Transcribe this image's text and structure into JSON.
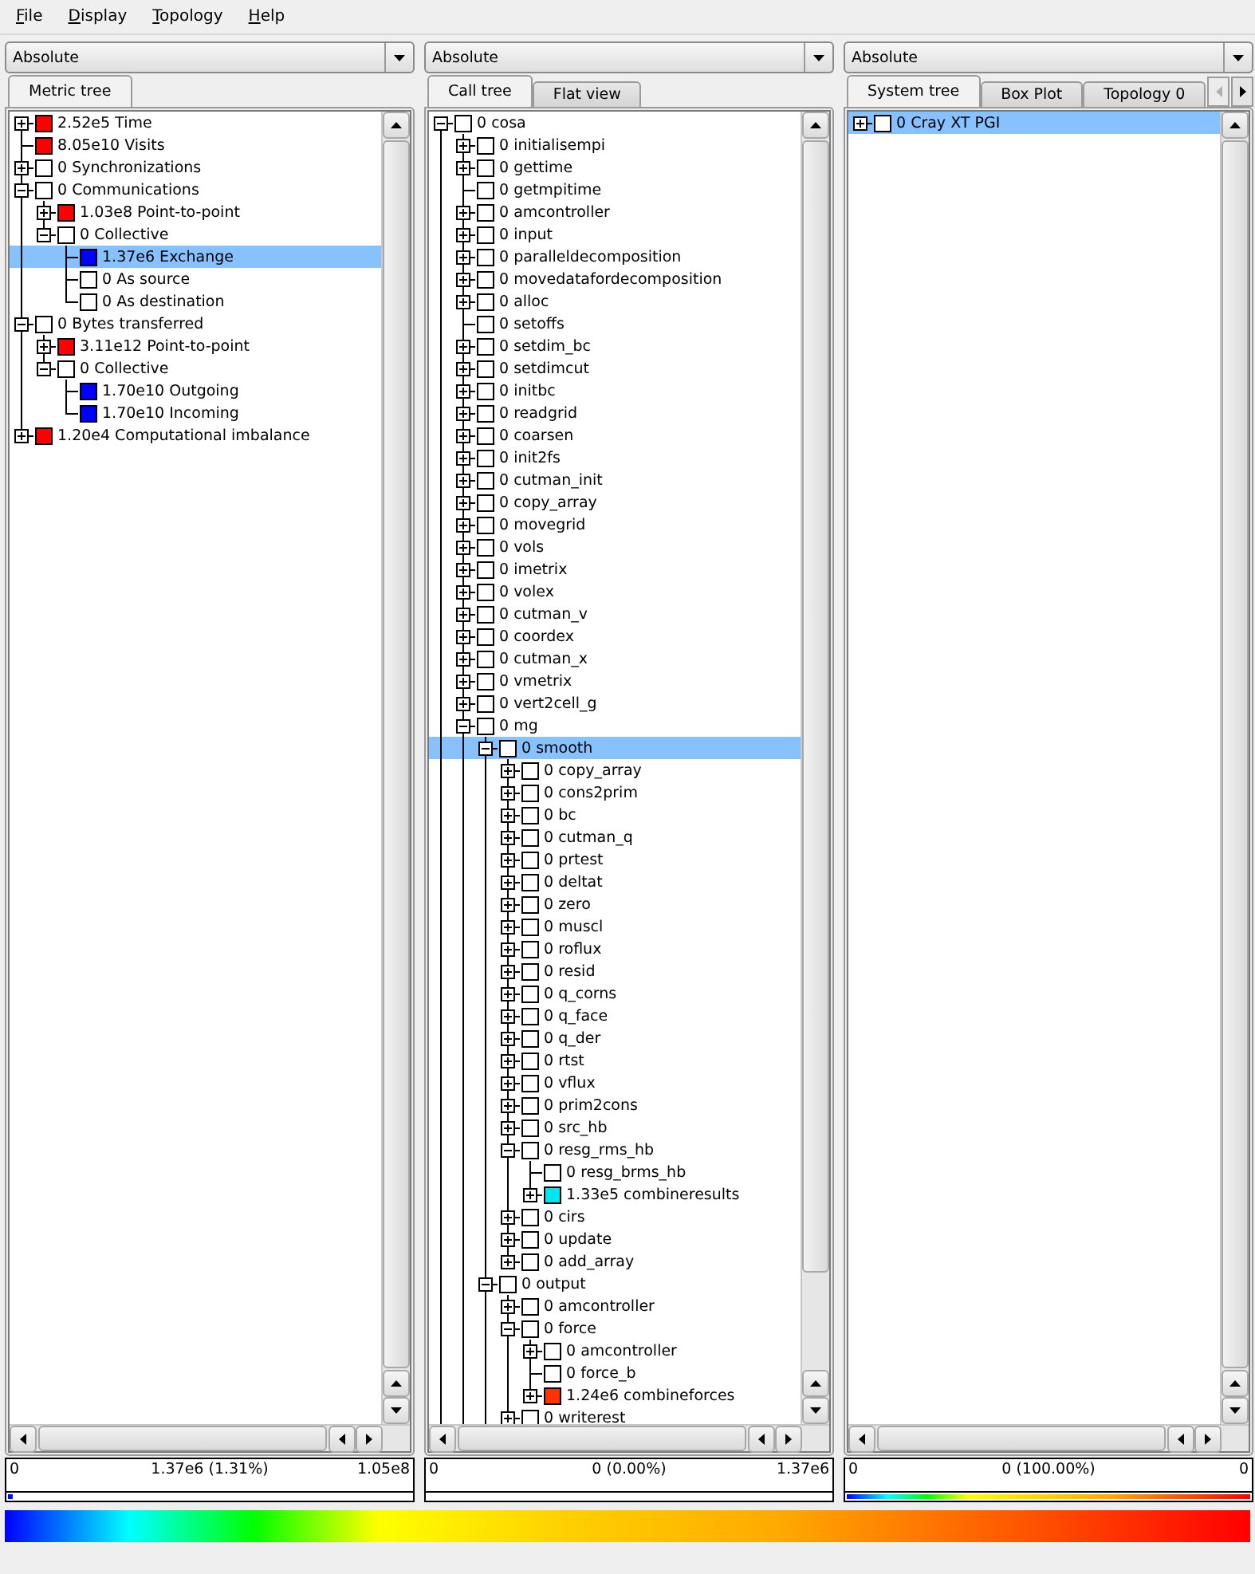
{
  "menu": [
    "File",
    "Display",
    "Topology",
    "Help"
  ],
  "panels": [
    {
      "mode": "Absolute",
      "tabs": [
        {
          "label": "Metric tree",
          "selected": true
        }
      ],
      "tree": [
        {
          "text": "2.52e5 Time",
          "color": "#ff0000",
          "expanded": false,
          "selected": false
        },
        {
          "text": "8.05e10 Visits",
          "color": "#ff0000",
          "selected": false
        },
        {
          "text": "0 Synchronizations",
          "color": "#ffffff",
          "expanded": false,
          "selected": false
        },
        {
          "text": "0 Communications",
          "color": "#ffffff",
          "expanded": true,
          "selected": false,
          "children": [
            {
              "text": "1.03e8 Point-to-point",
              "color": "#ff0000",
              "expanded": false,
              "selected": false
            },
            {
              "text": "0 Collective",
              "color": "#ffffff",
              "expanded": true,
              "selected": false,
              "children": [
                {
                  "text": "1.37e6 Exchange",
                  "color": "#0000ff",
                  "selected": true
                },
                {
                  "text": "0 As source",
                  "color": "#ffffff",
                  "selected": false
                },
                {
                  "text": "0 As destination",
                  "color": "#ffffff",
                  "selected": false
                }
              ]
            }
          ]
        },
        {
          "text": "0 Bytes transferred",
          "color": "#ffffff",
          "expanded": true,
          "selected": false,
          "children": [
            {
              "text": "3.11e12 Point-to-point",
              "color": "#ff0000",
              "expanded": false,
              "selected": false
            },
            {
              "text": "0 Collective",
              "color": "#ffffff",
              "expanded": true,
              "selected": false,
              "children": [
                {
                  "text": "1.70e10 Outgoing",
                  "color": "#0000ff",
                  "selected": false
                },
                {
                  "text": "1.70e10 Incoming",
                  "color": "#0000ff",
                  "selected": false
                }
              ]
            }
          ]
        },
        {
          "text": "1.20e4 Computational imbalance",
          "color": "#ff0000",
          "expanded": false,
          "selected": false
        }
      ],
      "value_display": {
        "min": "0",
        "value": "1.37e6 (1.31%)",
        "max": "1.05e8",
        "level": 0.0131
      }
    },
    {
      "mode": "Absolute",
      "tabs": [
        {
          "label": "Call tree",
          "selected": true
        },
        {
          "label": "Flat view",
          "selected": false
        }
      ],
      "tree": [
        {
          "text": "0 cosa",
          "color": "#ffffff",
          "expanded": true,
          "selected": false,
          "continued": true,
          "children": [
            {
              "text": "0 initialisempi",
              "color": "#ffffff",
              "expanded": false,
              "selected": false
            },
            {
              "text": "0 gettime",
              "color": "#ffffff",
              "expanded": false,
              "selected": false
            },
            {
              "text": "0 getmpitime",
              "color": "#ffffff",
              "selected": false
            },
            {
              "text": "0 amcontroller",
              "color": "#ffffff",
              "expanded": false,
              "selected": false
            },
            {
              "text": "0 input",
              "color": "#ffffff",
              "expanded": false,
              "selected": false
            },
            {
              "text": "0 paralleldecomposition",
              "color": "#ffffff",
              "expanded": false,
              "selected": false
            },
            {
              "text": "0 movedatafordecomposition",
              "color": "#ffffff",
              "expanded": false,
              "selected": false
            },
            {
              "text": "0 alloc",
              "color": "#ffffff",
              "expanded": false,
              "selected": false
            },
            {
              "text": "0 setoffs",
              "color": "#ffffff",
              "selected": false
            },
            {
              "text": "0 setdim_bc",
              "color": "#ffffff",
              "expanded": false,
              "selected": false
            },
            {
              "text": "0 setdimcut",
              "color": "#ffffff",
              "expanded": false,
              "selected": false
            },
            {
              "text": "0 initbc",
              "color": "#ffffff",
              "expanded": false,
              "selected": false
            },
            {
              "text": "0 readgrid",
              "color": "#ffffff",
              "expanded": false,
              "selected": false
            },
            {
              "text": "0 coarsen",
              "color": "#ffffff",
              "expanded": false,
              "selected": false
            },
            {
              "text": "0 init2fs",
              "color": "#ffffff",
              "expanded": false,
              "selected": false
            },
            {
              "text": "0 cutman_init",
              "color": "#ffffff",
              "expanded": false,
              "selected": false
            },
            {
              "text": "0 copy_array",
              "color": "#ffffff",
              "expanded": false,
              "selected": false
            },
            {
              "text": "0 movegrid",
              "color": "#ffffff",
              "expanded": false,
              "selected": false
            },
            {
              "text": "0 vols",
              "color": "#ffffff",
              "expanded": false,
              "selected": false
            },
            {
              "text": "0 imetrix",
              "color": "#ffffff",
              "expanded": false,
              "selected": false
            },
            {
              "text": "0 volex",
              "color": "#ffffff",
              "expanded": false,
              "selected": false
            },
            {
              "text": "0 cutman_v",
              "color": "#ffffff",
              "expanded": false,
              "selected": false
            },
            {
              "text": "0 coordex",
              "color": "#ffffff",
              "expanded": false,
              "selected": false
            },
            {
              "text": "0 cutman_x",
              "color": "#ffffff",
              "expanded": false,
              "selected": false
            },
            {
              "text": "0 vmetrix",
              "color": "#ffffff",
              "expanded": false,
              "selected": false
            },
            {
              "text": "0 vert2cell_g",
              "color": "#ffffff",
              "expanded": false,
              "selected": false
            },
            {
              "text": "0 mg",
              "color": "#ffffff",
              "expanded": true,
              "selected": false,
              "continued": true,
              "children": [
                {
                  "text": "0 smooth",
                  "color": "#ffffff",
                  "expanded": true,
                  "selected": true,
                  "children": [
                    {
                      "text": "0 copy_array",
                      "color": "#ffffff",
                      "expanded": false,
                      "selected": false
                    },
                    {
                      "text": "0 cons2prim",
                      "color": "#ffffff",
                      "expanded": false,
                      "selected": false
                    },
                    {
                      "text": "0 bc",
                      "color": "#ffffff",
                      "expanded": false,
                      "selected": false
                    },
                    {
                      "text": "0 cutman_q",
                      "color": "#ffffff",
                      "expanded": false,
                      "selected": false
                    },
                    {
                      "text": "0 prtest",
                      "color": "#ffffff",
                      "expanded": false,
                      "selected": false
                    },
                    {
                      "text": "0 deltat",
                      "color": "#ffffff",
                      "expanded": false,
                      "selected": false
                    },
                    {
                      "text": "0 zero",
                      "color": "#ffffff",
                      "expanded": false,
                      "selected": false
                    },
                    {
                      "text": "0 muscl",
                      "color": "#ffffff",
                      "expanded": false,
                      "selected": false
                    },
                    {
                      "text": "0 roflux",
                      "color": "#ffffff",
                      "expanded": false,
                      "selected": false
                    },
                    {
                      "text": "0 resid",
                      "color": "#ffffff",
                      "expanded": false,
                      "selected": false
                    },
                    {
                      "text": "0 q_corns",
                      "color": "#ffffff",
                      "expanded": false,
                      "selected": false
                    },
                    {
                      "text": "0 q_face",
                      "color": "#ffffff",
                      "expanded": false,
                      "selected": false
                    },
                    {
                      "text": "0 q_der",
                      "color": "#ffffff",
                      "expanded": false,
                      "selected": false
                    },
                    {
                      "text": "0 rtst",
                      "color": "#ffffff",
                      "expanded": false,
                      "selected": false
                    },
                    {
                      "text": "0 vflux",
                      "color": "#ffffff",
                      "expanded": false,
                      "selected": false
                    },
                    {
                      "text": "0 prim2cons",
                      "color": "#ffffff",
                      "expanded": false,
                      "selected": false
                    },
                    {
                      "text": "0 src_hb",
                      "color": "#ffffff",
                      "expanded": false,
                      "selected": false
                    },
                    {
                      "text": "0 resg_rms_hb",
                      "color": "#ffffff",
                      "expanded": true,
                      "selected": false,
                      "children": [
                        {
                          "text": "0 resg_brms_hb",
                          "color": "#ffffff",
                          "selected": false
                        },
                        {
                          "text": "1.33e5 combineresults",
                          "color": "#00e5ee",
                          "expanded": false,
                          "selected": false
                        }
                      ]
                    },
                    {
                      "text": "0 cirs",
                      "color": "#ffffff",
                      "expanded": false,
                      "selected": false
                    },
                    {
                      "text": "0 update",
                      "color": "#ffffff",
                      "expanded": false,
                      "selected": false
                    },
                    {
                      "text": "0 add_array",
                      "color": "#ffffff",
                      "expanded": false,
                      "selected": false
                    }
                  ]
                },
                {
                  "text": "0 output",
                  "color": "#ffffff",
                  "expanded": true,
                  "selected": false,
                  "continued": true,
                  "children": [
                    {
                      "text": "0 amcontroller",
                      "color": "#ffffff",
                      "expanded": false,
                      "selected": false
                    },
                    {
                      "text": "0 force",
                      "color": "#ffffff",
                      "expanded": true,
                      "selected": false,
                      "children": [
                        {
                          "text": "0 amcontroller",
                          "color": "#ffffff",
                          "expanded": false,
                          "selected": false
                        },
                        {
                          "text": "0 force_b",
                          "color": "#ffffff",
                          "selected": false
                        },
                        {
                          "text": "1.24e6 combineforces",
                          "color": "#ff3300",
                          "expanded": false,
                          "selected": false
                        }
                      ]
                    },
                    {
                      "text": "0 writerest",
                      "color": "#ffffff",
                      "expanded": false,
                      "selected": false
                    }
                  ]
                }
              ]
            }
          ]
        }
      ],
      "value_display": {
        "min": "0",
        "value": "0 (0.00%)",
        "max": "1.37e6",
        "level": 0
      }
    },
    {
      "mode": "Absolute",
      "tabs": [
        {
          "label": "System tree",
          "selected": true
        },
        {
          "label": "Box Plot",
          "selected": false
        },
        {
          "label": "Topology 0",
          "selected": false
        }
      ],
      "tab_scroller": {
        "back_disabled": true,
        "forward_disabled": false
      },
      "tree": [
        {
          "text": "0 Cray XT PGI",
          "color": "#ffffff",
          "expanded": false,
          "selected": true
        }
      ],
      "value_display": {
        "min": "0",
        "value": "0 (100.00%)",
        "max": "0",
        "level": 1
      }
    }
  ]
}
